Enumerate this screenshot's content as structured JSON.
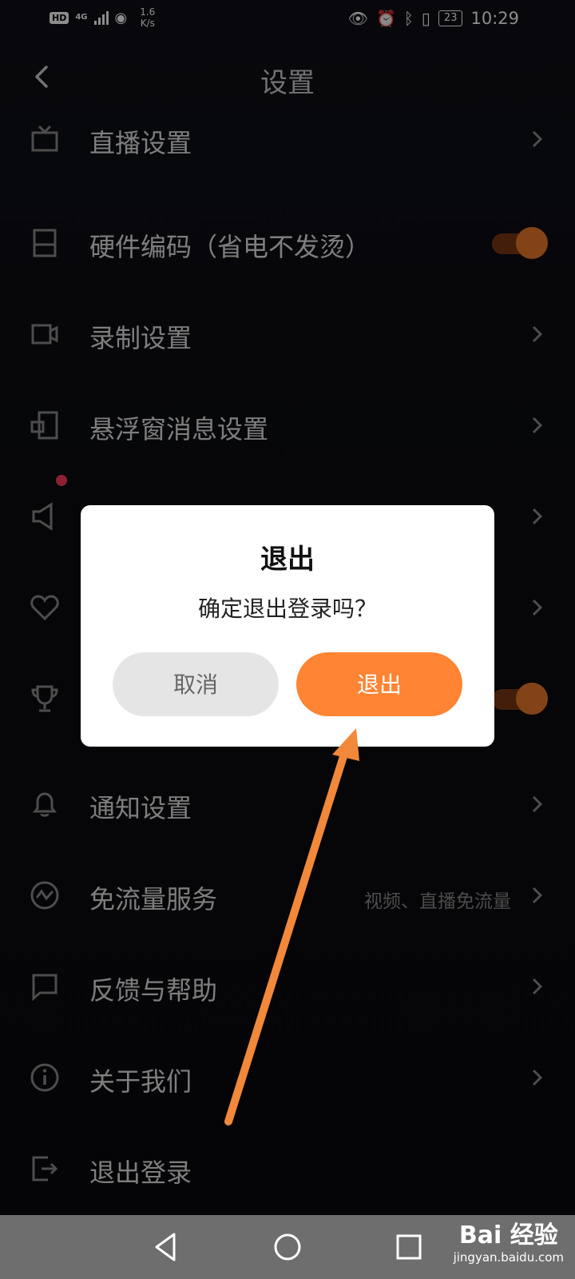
{
  "status_bar": {
    "hd": "HD",
    "network": "4G",
    "speed_value": "1.6",
    "speed_unit": "K/s",
    "battery": "23",
    "time": "10:29"
  },
  "header": {
    "title": "设置"
  },
  "settings": [
    {
      "label": "直播设置",
      "icon": "tv-icon",
      "control": "chevron"
    },
    {
      "label": "硬件编码（省电不发烫）",
      "icon": "panel-icon",
      "control": "toggle",
      "toggle_on": true
    },
    {
      "label": "录制设置",
      "icon": "camera-icon",
      "control": "chevron"
    },
    {
      "label": "悬浮窗消息设置",
      "icon": "float-window-icon",
      "control": "chevron"
    },
    {
      "label": "",
      "icon": "speaker-icon",
      "control": "chevron",
      "badge": true
    },
    {
      "label": "",
      "icon": "heart-icon",
      "control": "chevron"
    },
    {
      "label": "",
      "icon": "trophy-icon",
      "control": "toggle",
      "toggle_on": true
    },
    {
      "label": "通知设置",
      "icon": "bell-icon",
      "control": "chevron"
    },
    {
      "label": "免流量服务",
      "icon": "trend-icon",
      "control": "chevron",
      "extra": "视频、直播免流量"
    },
    {
      "label": "反馈与帮助",
      "icon": "message-icon",
      "control": "chevron"
    },
    {
      "label": "关于我们",
      "icon": "info-icon",
      "control": "chevron"
    },
    {
      "label": "退出登录",
      "icon": "logout-icon",
      "control": "none"
    }
  ],
  "dialog": {
    "title": "退出",
    "message": "确定退出登录吗？",
    "cancel": "取消",
    "confirm": "退出"
  },
  "watermark": {
    "brand": "Bai 经验",
    "site": "jingyan.baidu.com"
  },
  "colors": {
    "accent": "#ff8433",
    "toggle_track": "#7a3a14",
    "background": "#0e0e12"
  }
}
